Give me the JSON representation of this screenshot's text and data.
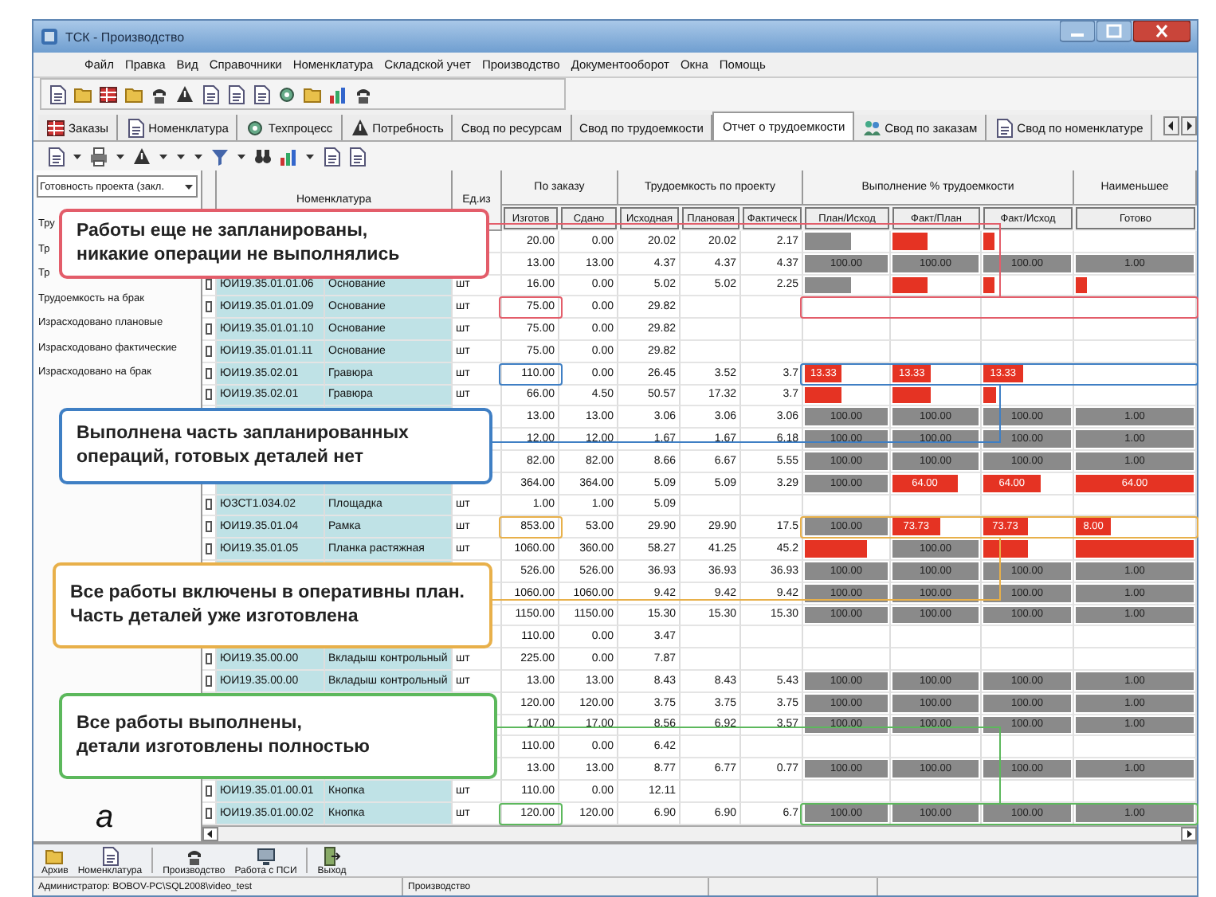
{
  "window": {
    "title": "ТСК - Производство"
  },
  "menu": [
    "Файл",
    "Правка",
    "Вид",
    "Справочники",
    "Номенклатура",
    "Складской учет",
    "Производство",
    "Документооборот",
    "Окна",
    "Помощь"
  ],
  "tabs": [
    {
      "label": "Заказы",
      "selected": false
    },
    {
      "label": "Номенклатура",
      "selected": false
    },
    {
      "label": "Техпроцесс",
      "selected": false
    },
    {
      "label": "Потребность",
      "selected": false
    },
    {
      "label": "Свод по ресурсам",
      "selected": false
    },
    {
      "label": "Свод по трудоемкости",
      "selected": false
    },
    {
      "label": "Отчет о трудоемкости",
      "selected": true
    },
    {
      "label": "Свод по заказам",
      "selected": false
    },
    {
      "label": "Свод по номенклатуре",
      "selected": false
    }
  ],
  "side_panel": {
    "selector": "Готовность проекта (закл.",
    "items": [
      "Тру",
      "Тр",
      "Тр",
      "Трудоемкость на брак",
      "Израсходовано плановые",
      "Израсходовано фактические",
      "Израсходовано на брак"
    ]
  },
  "table": {
    "columns": [
      {
        "label": "Номенклатура"
      },
      {
        "label": "Ед.из"
      },
      {
        "label": "По заказу",
        "sub": [
          "Изготов",
          "Сдано"
        ]
      },
      {
        "label": "Трудоемкость по проекту",
        "sub": [
          "Исходная",
          "Плановая",
          "Фактическ"
        ]
      },
      {
        "label": "Выполнение % трудоемкости",
        "sub": [
          "План/Исход",
          "Факт/План",
          "Факт/Исход"
        ]
      },
      {
        "label": "Наименьшее",
        "sub": [
          "Готово"
        ]
      }
    ],
    "rows": [
      {
        "qty": [
          "20.00",
          "0.00"
        ],
        "labor": [
          "20.02",
          "20.02",
          "2.17"
        ],
        "progress": [
          {
            "level": 0.55,
            "alert": false
          },
          {
            "level": 0.4,
            "alert": true
          },
          {
            "level": 0.12,
            "alert": true
          }
        ]
      },
      {
        "qty": [
          "13.00",
          "13.00"
        ],
        "labor": [
          "4.37",
          "4.37",
          "4.37"
        ],
        "progress": [
          {
            "level": 1,
            "alert": false,
            "text": "100.00"
          },
          {
            "level": 1,
            "alert": false,
            "text": "100.00"
          },
          {
            "level": 1,
            "alert": false,
            "text": "100.00"
          },
          {
            "level": 1,
            "alert": false,
            "text": "1.00"
          }
        ]
      },
      {
        "designation": "ЮИ19.35.01.01.06",
        "name": "Основание",
        "unit": "шт",
        "checked": false,
        "qty": [
          "16.00",
          "0.00"
        ],
        "labor": [
          "5.02",
          "5.02",
          "2.25"
        ],
        "progress": [
          {
            "level": 0.55,
            "alert": false
          },
          {
            "level": 0.4,
            "alert": true
          },
          {
            "level": 0.12,
            "alert": true
          },
          {
            "level": 0.1,
            "alert": true
          }
        ]
      },
      {
        "designation": "ЮИ19.35.01.01.09",
        "name": "Основание",
        "unit": "шт",
        "checked": false,
        "qty": [
          "75.00",
          "0.00"
        ],
        "labor": [
          "29.82"
        ]
      },
      {
        "designation": "ЮИ19.35.01.01.10",
        "name": "Основание",
        "unit": "шт",
        "checked": false,
        "qty": [
          "75.00",
          "0.00"
        ],
        "labor": [
          "29.82"
        ]
      },
      {
        "designation": "ЮИ19.35.01.01.11",
        "name": "Основание",
        "unit": "шт",
        "checked": false,
        "qty": [
          "75.00",
          "0.00"
        ],
        "labor": [
          "29.82"
        ]
      },
      {
        "designation": "ЮИ19.35.02.01",
        "name": "Гравюра",
        "unit": "шт",
        "checked": false,
        "qty": [
          "110.00",
          "0.00"
        ],
        "labor": [
          "26.45",
          "3.52",
          "3.7"
        ],
        "progress": [
          {
            "level": 0.45,
            "alert": true,
            "text": "13.33"
          },
          {
            "level": 0.45,
            "alert": true,
            "text": "13.33"
          },
          {
            "level": 0.45,
            "alert": true,
            "text": "13.33"
          }
        ]
      },
      {
        "designation": "ЮИ19.35.02.01",
        "name": "Гравюра",
        "unit": "шт",
        "checked": false,
        "qty": [
          "66.00",
          "4.50"
        ],
        "labor": [
          "50.57",
          "17.32",
          "3.7"
        ],
        "progress": [
          {
            "level": 0.45,
            "alert": true
          },
          {
            "level": 0.45,
            "alert": true
          },
          {
            "level": 0.15,
            "alert": true
          }
        ]
      },
      {
        "qty": [
          "13.00",
          "13.00"
        ],
        "labor": [
          "3.06",
          "3.06",
          "3.06"
        ],
        "progress": [
          {
            "level": 1,
            "alert": false,
            "text": "100.00"
          },
          {
            "level": 1,
            "alert": false,
            "text": "100.00"
          },
          {
            "level": 1,
            "alert": false,
            "text": "100.00"
          },
          {
            "level": 1,
            "alert": false,
            "text": "1.00"
          }
        ]
      },
      {
        "qty": [
          "12.00",
          "12.00"
        ],
        "labor": [
          "1.67",
          "1.67",
          "6.18"
        ],
        "progress": [
          {
            "level": 1,
            "alert": false,
            "text": "100.00"
          },
          {
            "level": 1,
            "alert": false,
            "text": "100.00"
          },
          {
            "level": 1,
            "alert": false,
            "text": "100.00"
          },
          {
            "level": 1,
            "alert": false,
            "text": "1.00"
          }
        ]
      },
      {
        "qty": [
          "82.00",
          "82.00"
        ],
        "labor": [
          "8.66",
          "6.67",
          "5.55"
        ],
        "progress": [
          {
            "level": 1,
            "alert": false,
            "text": "100.00"
          },
          {
            "level": 1,
            "alert": false,
            "text": "100.00"
          },
          {
            "level": 1,
            "alert": false,
            "text": "100.00"
          },
          {
            "level": 1,
            "alert": false,
            "text": "1.00"
          }
        ]
      },
      {
        "qty": [
          "364.00",
          "364.00"
        ],
        "labor": [
          "5.09",
          "5.09",
          "3.29"
        ],
        "progress": [
          {
            "level": 1,
            "alert": false,
            "text": "100.00"
          },
          {
            "level": 0.75,
            "alert": true,
            "text": "64.00"
          },
          {
            "level": 0.65,
            "alert": true,
            "text": "64.00"
          },
          {
            "level": 1,
            "alert": true,
            "text": "64.00"
          }
        ]
      },
      {
        "designation": "ЮЗСТ1.034.02",
        "name": "Площадка",
        "unit": "шт",
        "checked": false,
        "qty": [
          "1.00",
          "1.00"
        ],
        "labor": [
          "5.09"
        ]
      },
      {
        "designation": "ЮИ19.35.01.04",
        "name": "Рамка",
        "unit": "шт",
        "checked": false,
        "qty": [
          "853.00",
          "53.00"
        ],
        "labor": [
          "29.90",
          "29.90",
          "17.5"
        ],
        "progress": [
          {
            "level": 1,
            "alert": false,
            "text": "100.00"
          },
          {
            "level": 0.55,
            "alert": true,
            "text": "73.73"
          },
          {
            "level": 0.5,
            "alert": true,
            "text": "73.73"
          },
          {
            "level": 0.3,
            "alert": true,
            "text": "8.00"
          }
        ]
      },
      {
        "designation": "ЮИ19.35.01.05",
        "name": "Планка растяжная",
        "unit": "шт",
        "checked": false,
        "qty": [
          "1060.00",
          "360.00"
        ],
        "labor": [
          "58.27",
          "41.25",
          "45.2"
        ],
        "progress": [
          {
            "level": 0.75,
            "alert": true
          },
          {
            "level": 1,
            "alert": false,
            "text": "100.00"
          },
          {
            "level": 0.5,
            "alert": true
          },
          {
            "level": 1,
            "alert": true
          }
        ]
      },
      {
        "qty": [
          "526.00",
          "526.00"
        ],
        "labor": [
          "36.93",
          "36.93",
          "36.93"
        ],
        "progress": [
          {
            "level": 1,
            "alert": false,
            "text": "100.00"
          },
          {
            "level": 1,
            "alert": false,
            "text": "100.00"
          },
          {
            "level": 1,
            "alert": false,
            "text": "100.00"
          },
          {
            "level": 1,
            "alert": false,
            "text": "1.00"
          }
        ]
      },
      {
        "qty": [
          "1060.00",
          "1060.00"
        ],
        "labor": [
          "9.42",
          "9.42",
          "9.42"
        ],
        "progress": [
          {
            "level": 1,
            "alert": false,
            "text": "100.00"
          },
          {
            "level": 1,
            "alert": false,
            "text": "100.00"
          },
          {
            "level": 1,
            "alert": false,
            "text": "100.00"
          },
          {
            "level": 1,
            "alert": false,
            "text": "1.00"
          }
        ]
      },
      {
        "qty": [
          "1150.00",
          "1150.00"
        ],
        "labor": [
          "15.30",
          "15.30",
          "15.30"
        ],
        "progress": [
          {
            "level": 1,
            "alert": false,
            "text": "100.00"
          },
          {
            "level": 1,
            "alert": false,
            "text": "100.00"
          },
          {
            "level": 1,
            "alert": false,
            "text": "100.00"
          },
          {
            "level": 1,
            "alert": false,
            "text": "1.00"
          }
        ]
      },
      {
        "qty": [
          "110.00",
          "0.00"
        ],
        "labor": [
          "3.47"
        ]
      },
      {
        "designation": "ЮИ19.35.00.00",
        "name": "Вкладыш контрольный",
        "unit": "шт",
        "checked": false,
        "qty": [
          "225.00",
          "0.00"
        ],
        "labor": [
          "7.87"
        ]
      },
      {
        "designation": "ЮИ19.35.00.00",
        "name": "Вкладыш контрольный",
        "unit": "шт",
        "checked": false,
        "qty": [
          "13.00",
          "13.00"
        ],
        "labor": [
          "8.43",
          "8.43",
          "5.43"
        ],
        "progress": [
          {
            "level": 1,
            "alert": false,
            "text": "100.00"
          },
          {
            "level": 1,
            "alert": false,
            "text": "100.00"
          },
          {
            "level": 1,
            "alert": false,
            "text": "100.00"
          },
          {
            "level": 1,
            "alert": false,
            "text": "1.00"
          }
        ]
      },
      {
        "qty": [
          "120.00",
          "120.00"
        ],
        "labor": [
          "3.75",
          "3.75",
          "3.75"
        ],
        "progress": [
          {
            "level": 1,
            "alert": false,
            "text": "100.00"
          },
          {
            "level": 1,
            "alert": false,
            "text": "100.00"
          },
          {
            "level": 1,
            "alert": false,
            "text": "100.00"
          },
          {
            "level": 1,
            "alert": false,
            "text": "1.00"
          }
        ]
      },
      {
        "qty": [
          "17.00",
          "17.00"
        ],
        "labor": [
          "8.56",
          "6.92",
          "3.57"
        ],
        "progress": [
          {
            "level": 1,
            "alert": false,
            "text": "100.00"
          },
          {
            "level": 1,
            "alert": false,
            "text": "100.00"
          },
          {
            "level": 1,
            "alert": false,
            "text": "100.00"
          },
          {
            "level": 1,
            "alert": false,
            "text": "1.00"
          }
        ]
      },
      {
        "qty": [
          "110.00",
          "0.00"
        ],
        "labor": [
          "6.42"
        ]
      },
      {
        "qty": [
          "13.00",
          "13.00"
        ],
        "labor": [
          "8.77",
          "6.77",
          "0.77"
        ],
        "progress": [
          {
            "level": 1,
            "alert": false,
            "text": "100.00"
          },
          {
            "level": 1,
            "alert": false,
            "text": "100.00"
          },
          {
            "level": 1,
            "alert": false,
            "text": "100.00"
          },
          {
            "level": 1,
            "alert": false,
            "text": "1.00"
          }
        ]
      },
      {
        "designation": "ЮИ19.35.01.00.01",
        "name": "Кнопка",
        "unit": "шт",
        "checked": false,
        "qty": [
          "110.00",
          "0.00"
        ],
        "labor": [
          "12.11"
        ]
      },
      {
        "designation": "ЮИ19.35.01.00.02",
        "name": "Кнопка",
        "unit": "шт",
        "checked": false,
        "qty": [
          "120.00",
          "120.00"
        ],
        "labor": [
          "6.90",
          "6.90",
          "6.7"
        ],
        "progress": [
          {
            "level": 1,
            "alert": false,
            "text": "100.00"
          },
          {
            "level": 1,
            "alert": false,
            "text": "100.00"
          },
          {
            "level": 1,
            "alert": false,
            "text": "100.00"
          },
          {
            "level": 1,
            "alert": false,
            "text": "1.00"
          }
        ]
      }
    ]
  },
  "callouts": [
    {
      "text": "Работы еще не запланированы,\nникакие операции не выполнялись",
      "color": "#e35d6a"
    },
    {
      "text": "Выполнена часть запланированных\nопераций, готовых деталей нет",
      "color": "#3f7fc4"
    },
    {
      "text": "Все работы включены в оперативны план.\nЧасть деталей уже изготовлена",
      "color": "#e8b04a"
    },
    {
      "text": "Все работы выполнены,\nдетали изготовлены полностью",
      "color": "#5cb85c"
    }
  ],
  "figure_label": "а",
  "bottom_bar": [
    "Архив",
    "Номенклатура",
    "Производство",
    "Работа с ПСИ",
    "Выход"
  ],
  "status_bar": [
    "Администратор: BOBOV-PC\\SQL2008\\video_test",
    "Производство"
  ]
}
